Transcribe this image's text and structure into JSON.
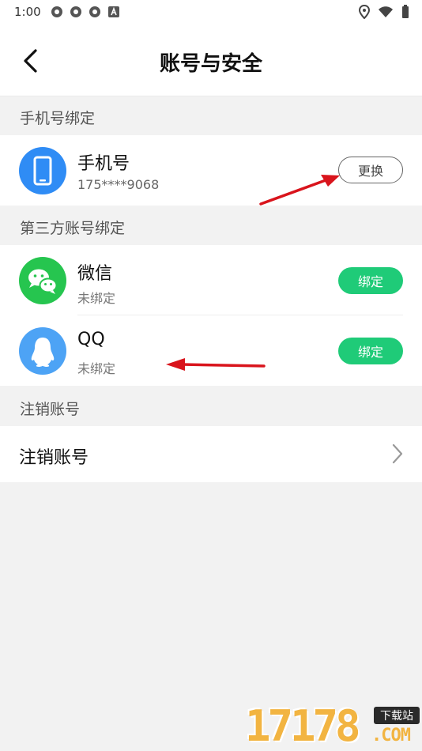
{
  "status_bar": {
    "time": "1:00"
  },
  "nav": {
    "title": "账号与安全"
  },
  "sections": {
    "phone": {
      "label": "手机号绑定",
      "title": "手机号",
      "value": "175****9068",
      "button": "更换"
    },
    "third_party": {
      "label": "第三方账号绑定",
      "items": [
        {
          "title": "微信",
          "status": "未绑定",
          "button": "绑定"
        },
        {
          "title": "QQ",
          "status": "未绑定",
          "button": "绑定"
        }
      ]
    },
    "cancel": {
      "label": "注销账号",
      "item": "注销账号"
    }
  },
  "watermark": {
    "number": "17178",
    "tag": "下载站",
    "domain": ".COM"
  },
  "colors": {
    "green": "#1fcb78",
    "phone_icon_bg": "#2f8cf5",
    "wechat_bg": "#26c54f",
    "qq_bg": "#4da3f5",
    "annotation_arrow": "#d9141c"
  },
  "icons": [
    "back-arrow-icon",
    "phone-icon",
    "wechat-icon",
    "qq-icon",
    "chevron-right-icon",
    "location-icon",
    "wifi-icon",
    "battery-icon"
  ]
}
